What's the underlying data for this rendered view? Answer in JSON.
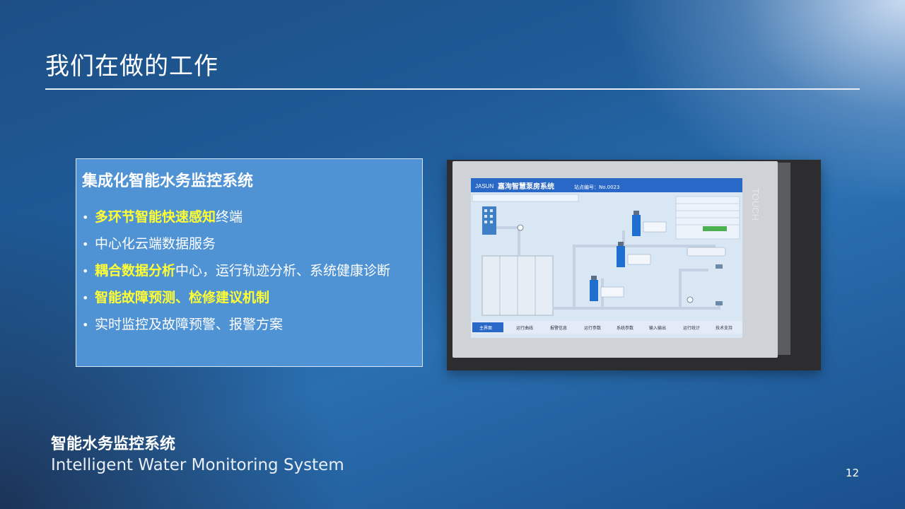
{
  "slide": {
    "title": "我们在做的工作",
    "page_number": "12"
  },
  "info_box": {
    "title": "集成化智能水务监控系统",
    "bullets": [
      {
        "highlight": "多环节智能快速感知",
        "text": "终端"
      },
      {
        "highlight": "",
        "text": "中心化云端数据服务"
      },
      {
        "highlight": "耦合数据分析",
        "text": "中心，运行轨迹分析、系统健康诊断"
      },
      {
        "highlight": "智能故障预测、检修建议机制",
        "text": ""
      },
      {
        "highlight": "",
        "text": "实时监控及故障预警、报警方案"
      }
    ]
  },
  "photo": {
    "description_icon": "monitoring-screen-photo",
    "screen_brand": "JASUN",
    "screen_title": "嘉洵智慧泵房系统",
    "station_label": "站点编号：No.0023",
    "bezel_label": "TOUCH",
    "nav_tabs": [
      "主界面",
      "运行曲线",
      "报警信息",
      "运行参数",
      "系统参数",
      "输入输出",
      "运行统计",
      "技术支持"
    ],
    "colors": {
      "screen_header": "#2a68c8",
      "screen_bg": "#d7e6f6",
      "pipe": "#c8d6e6",
      "pump": "#1f6fd1"
    }
  },
  "footer": {
    "title_cn": "智能水务监控系统",
    "title_en": "Intelligent Water Monitoring System"
  },
  "theme": {
    "accent_highlight": "#ffff33",
    "box_fill": "#4f93d4"
  }
}
